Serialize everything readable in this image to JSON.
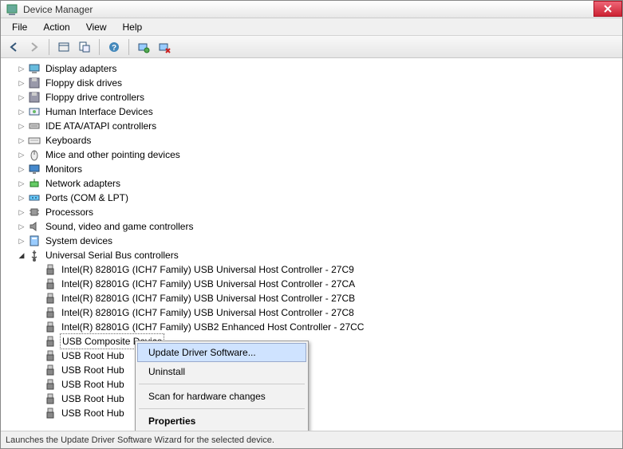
{
  "window": {
    "title": "Device Manager"
  },
  "menu": {
    "file": "File",
    "action": "Action",
    "view": "View",
    "help": "Help"
  },
  "tree": {
    "items": [
      {
        "label": "Display adapters",
        "icon": "display"
      },
      {
        "label": "Floppy disk drives",
        "icon": "floppy"
      },
      {
        "label": "Floppy drive controllers",
        "icon": "floppy"
      },
      {
        "label": "Human Interface Devices",
        "icon": "hid"
      },
      {
        "label": "IDE ATA/ATAPI controllers",
        "icon": "ide"
      },
      {
        "label": "Keyboards",
        "icon": "keyboard"
      },
      {
        "label": "Mice and other pointing devices",
        "icon": "mouse"
      },
      {
        "label": "Monitors",
        "icon": "monitor"
      },
      {
        "label": "Network adapters",
        "icon": "network"
      },
      {
        "label": "Ports (COM & LPT)",
        "icon": "port"
      },
      {
        "label": "Processors",
        "icon": "cpu"
      },
      {
        "label": "Sound, video and game controllers",
        "icon": "sound"
      },
      {
        "label": "System devices",
        "icon": "system"
      },
      {
        "label": "Universal Serial Bus controllers",
        "icon": "usb",
        "expanded": true
      }
    ],
    "usb_children": [
      "Intel(R) 82801G (ICH7 Family) USB Universal Host Controller - 27C9",
      "Intel(R) 82801G (ICH7 Family) USB Universal Host Controller - 27CA",
      "Intel(R) 82801G (ICH7 Family) USB Universal Host Controller - 27CB",
      "Intel(R) 82801G (ICH7 Family) USB Universal Host Controller - 27C8",
      "Intel(R) 82801G (ICH7 Family) USB2 Enhanced Host Controller - 27CC",
      "USB Composite Device",
      "USB Root Hub",
      "USB Root Hub",
      "USB Root Hub",
      "USB Root Hub",
      "USB Root Hub"
    ],
    "selected_index": 5
  },
  "context_menu": {
    "update": "Update Driver Software...",
    "uninstall": "Uninstall",
    "scan": "Scan for hardware changes",
    "properties": "Properties"
  },
  "statusbar": {
    "text": "Launches the Update Driver Software Wizard for the selected device."
  }
}
